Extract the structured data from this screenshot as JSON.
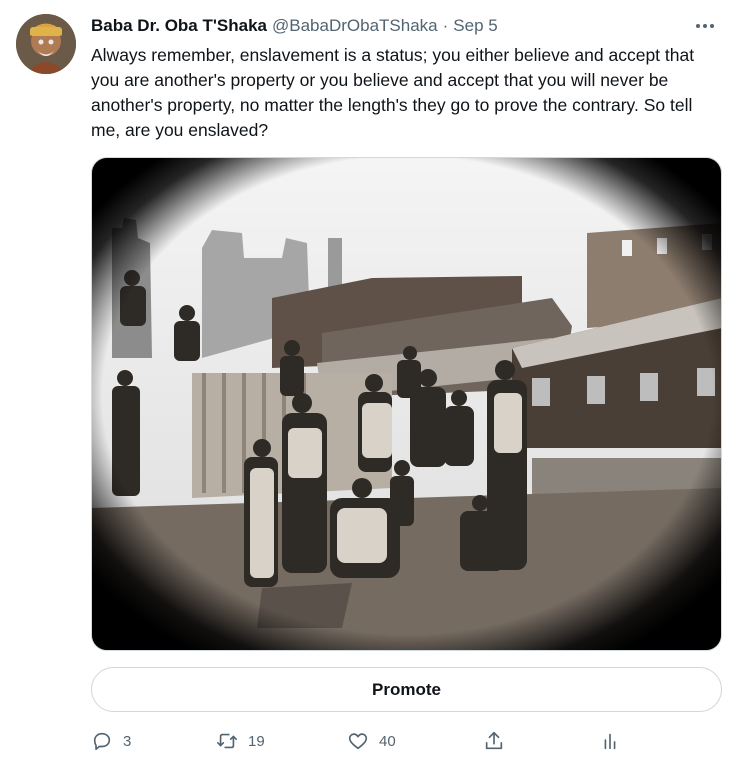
{
  "author": {
    "name": "Baba Dr. Oba T'Shaka",
    "handle": "@BabaDrObaTShaka",
    "separator": "·",
    "date": "Sep 5"
  },
  "tweet": {
    "text": "Always remember, enslavement is a status; you either believe and accept that you are another's property or you believe and accept that you will never be another's property, no matter the length's they go to prove the contrary. So tell me, are you enslaved?"
  },
  "media": {
    "type": "photo",
    "style": "black-and-white vignette"
  },
  "promote_label": "Promote",
  "metrics": {
    "replies": "3",
    "retweets": "19",
    "likes": "40"
  },
  "icons": [
    "more-icon",
    "reply-icon",
    "retweet-icon",
    "like-icon",
    "share-icon",
    "analytics-icon"
  ],
  "colors": {
    "text": "#0f1419",
    "secondary": "#536471",
    "border": "#cfd9de"
  }
}
